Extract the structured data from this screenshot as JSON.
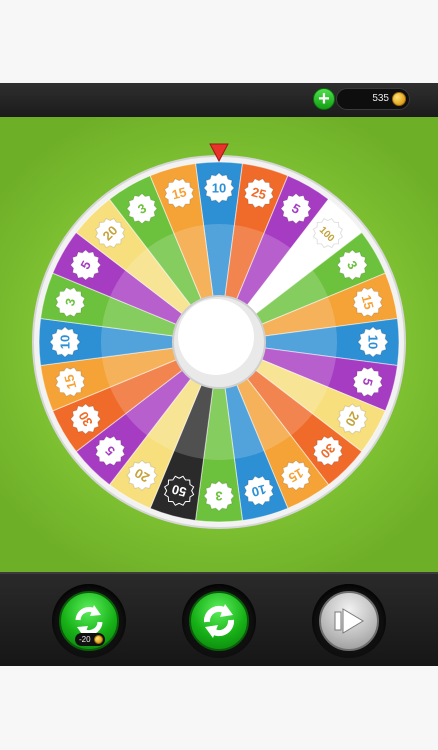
{
  "header": {
    "add_coins_label": "+",
    "coin_balance": "535"
  },
  "wheel": {
    "segments": [
      {
        "label": "10",
        "color": "#2d8fd4"
      },
      {
        "label": "25",
        "color": "#f06a2a"
      },
      {
        "label": "5",
        "color": "#a63cc2"
      },
      {
        "label": "100",
        "color": "#ffffff"
      },
      {
        "label": "3",
        "color": "#6cc23c"
      },
      {
        "label": "15",
        "color": "#f5a236"
      },
      {
        "label": "10",
        "color": "#2d8fd4"
      },
      {
        "label": "5",
        "color": "#a63cc2"
      },
      {
        "label": "20",
        "color": "#f7df7e"
      },
      {
        "label": "30",
        "color": "#f06a2a"
      },
      {
        "label": "15",
        "color": "#f5a236"
      },
      {
        "label": "10",
        "color": "#2d8fd4"
      },
      {
        "label": "3",
        "color": "#6cc23c"
      },
      {
        "label": "50",
        "color": "#2a2a2a"
      },
      {
        "label": "20",
        "color": "#f7df7e"
      },
      {
        "label": "5",
        "color": "#a63cc2"
      },
      {
        "label": "30",
        "color": "#f06a2a"
      },
      {
        "label": "15",
        "color": "#f5a236"
      },
      {
        "label": "10",
        "color": "#2d8fd4"
      },
      {
        "label": "3",
        "color": "#6cc23c"
      },
      {
        "label": "5",
        "color": "#a63cc2"
      },
      {
        "label": "20",
        "color": "#f7df7e"
      },
      {
        "label": "3",
        "color": "#6cc23c"
      },
      {
        "label": "15",
        "color": "#f5a236"
      }
    ],
    "pointer_color": "#e8332a"
  },
  "controls": {
    "paid_spin_cost": "-20",
    "paid_spin_icon": "refresh-arrows-icon",
    "free_spin_icon": "refresh-arrows-icon",
    "next_icon": "play-arrow-icon"
  }
}
